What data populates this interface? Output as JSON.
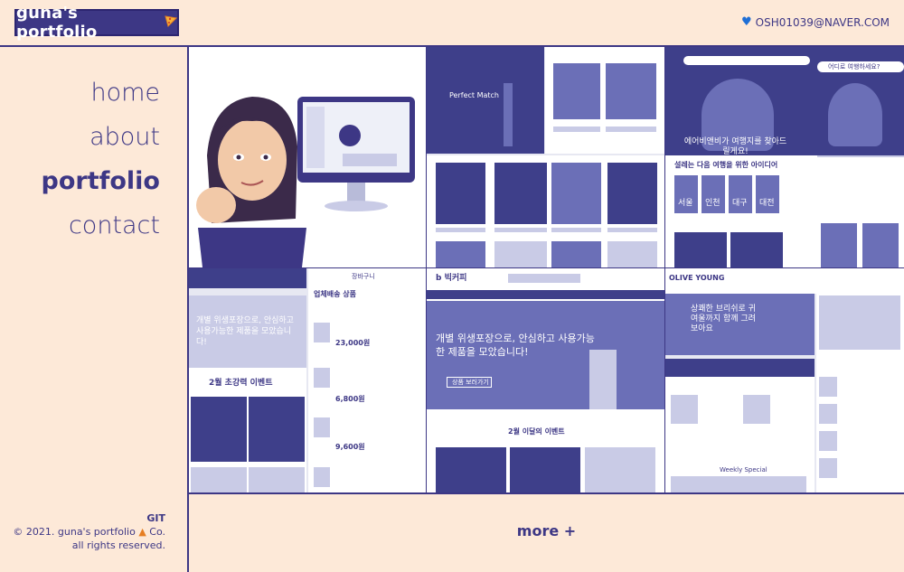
{
  "header": {
    "logo_text": "guna's portfolio",
    "logo_icon": "pizza-icon",
    "email_icon": "heart-icon",
    "email": "OSH01039@NAVER.COM"
  },
  "nav": {
    "items": [
      {
        "label": "home",
        "active": false
      },
      {
        "label": "about",
        "active": false
      },
      {
        "label": "portfolio",
        "active": true
      },
      {
        "label": "contact",
        "active": false
      }
    ]
  },
  "footer": {
    "git_label": "GIT",
    "copyright": "© 2021. guna's portfolio",
    "copyright_suffix": "Co.",
    "rights": "all rights reserved."
  },
  "more_label": "more +",
  "projects": {
    "p2": {
      "headline": "Perfect Match"
    },
    "p3": {
      "search_hint": "어디로 여행하세요?",
      "hero_text": "에어비앤비가 여행지를 찾아드릴게요!",
      "section": "설레는 다음 여행을 위한 아이디어",
      "cities": [
        "서울",
        "인천",
        "대구",
        "대전"
      ]
    },
    "p4": {
      "banner": "개별 위생포장으로, 안심하고 사용가능한 제품을 모았습니다!",
      "event": "2월 초강력 이벤트",
      "cart_title": "장바구니",
      "cart_heading": "업체배송 상품",
      "price1": "23,000원",
      "price2": "6,800원",
      "price3": "9,600원"
    },
    "p5": {
      "brand": "b 빅커피",
      "banner": "개별 위생포장으로, 안심하고 사용가능한 제품을 모았습니다!",
      "event": "2월 이달의 이벤트",
      "button": "상품 보러가기"
    },
    "p6": {
      "brand": "OLIVE YOUNG",
      "banner": "상쾌한 브리쉬로 귀여울까지 함께 그려보아요",
      "section": "Weekly Special"
    }
  }
}
